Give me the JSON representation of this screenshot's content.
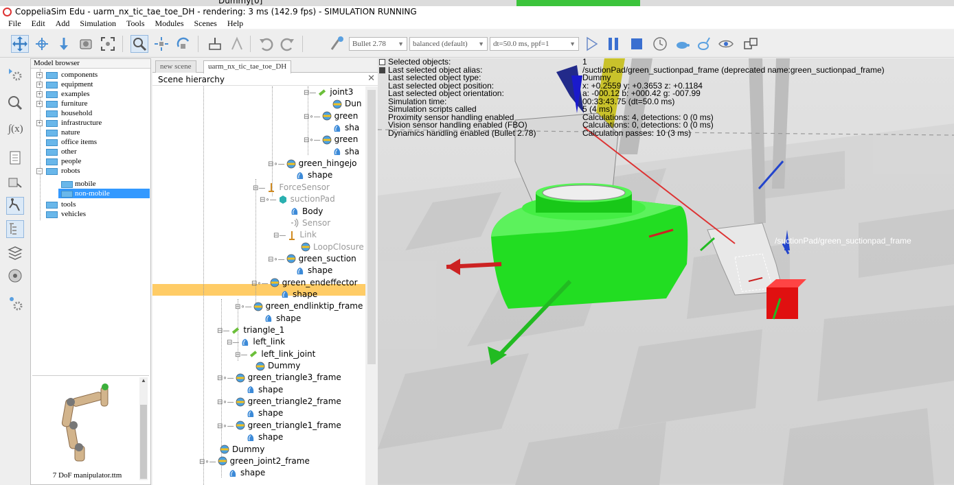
{
  "window": {
    "title": "CoppeliaSim Edu - uarm_nx_tic_tae_toe_DH - rendering: 3 ms (142.9 fps) - SIMULATION RUNNING",
    "top_strip_text": "Dummy[0]"
  },
  "menu": [
    "File",
    "Edit",
    "Add",
    "Simulation",
    "Tools",
    "Modules",
    "Scenes",
    "Help"
  ],
  "toolbar": {
    "physics_engine": "Bullet 2.78",
    "accuracy": "balanced (default)",
    "timestep": "dt=50.0 ms, ppf=1"
  },
  "model_browser": {
    "title": "Model browser",
    "items": [
      {
        "label": "components",
        "expandable": true
      },
      {
        "label": "equipment",
        "expandable": true
      },
      {
        "label": "examples",
        "expandable": true
      },
      {
        "label": "furniture",
        "expandable": true
      },
      {
        "label": "household",
        "expandable": false
      },
      {
        "label": "infrastructure",
        "expandable": true
      },
      {
        "label": "nature",
        "expandable": false
      },
      {
        "label": "office items",
        "expandable": false
      },
      {
        "label": "other",
        "expandable": false
      },
      {
        "label": "people",
        "expandable": false
      },
      {
        "label": "robots",
        "expandable": true
      },
      {
        "label": "mobile",
        "expandable": false
      },
      {
        "label": "non-mobile",
        "expandable": false,
        "selected": true
      },
      {
        "label": "tools",
        "expandable": false
      },
      {
        "label": "vehicles",
        "expandable": false
      }
    ],
    "thumbnail_caption": "7 DoF manipulator.ttm"
  },
  "scene": {
    "tabs": [
      "new scene",
      "uarm_nx_tic_tae_toe_DH"
    ],
    "active_tab": "uarm_nx_tic_tae_toe_DH",
    "hierarchy_title": "Scene hierarchy",
    "rows": [
      {
        "label": "joint3",
        "indent": 220,
        "icon": "joint",
        "exp": "⊟"
      },
      {
        "label": "Dun",
        "indent": 262,
        "icon": "dummy",
        "exp": ""
      },
      {
        "label": "green",
        "indent": 220,
        "icon": "dummy",
        "exp": "⊟∘"
      },
      {
        "label": "sha",
        "indent": 262,
        "icon": "shape",
        "exp": ""
      },
      {
        "label": "green",
        "indent": 220,
        "icon": "dummy",
        "exp": "⊟∘"
      },
      {
        "label": "sha",
        "indent": 262,
        "icon": "shape",
        "exp": ""
      },
      {
        "label": "green_hingejo",
        "indent": 168,
        "icon": "dummy",
        "exp": "⊟∘"
      },
      {
        "label": "shape",
        "indent": 208,
        "icon": "shape",
        "exp": ""
      },
      {
        "label": "ForceSensor",
        "indent": 146,
        "icon": "force",
        "exp": "⊟",
        "dim": true
      },
      {
        "label": "suctionPad",
        "indent": 156,
        "icon": "cube",
        "exp": "⊟∘",
        "dim": true
      },
      {
        "label": "Body",
        "indent": 200,
        "icon": "shape",
        "exp": ""
      },
      {
        "label": "Sensor",
        "indent": 200,
        "icon": "sensor",
        "exp": "",
        "dim": true
      },
      {
        "label": "Link",
        "indent": 176,
        "icon": "force",
        "exp": "⊟",
        "dim": true
      },
      {
        "label": "LoopClosure",
        "indent": 216,
        "icon": "dummy",
        "exp": "",
        "dim": true
      },
      {
        "label": "green_suction",
        "indent": 168,
        "icon": "dummy",
        "exp": "⊟∘",
        "selected": true
      },
      {
        "label": "shape",
        "indent": 208,
        "icon": "shape",
        "exp": ""
      },
      {
        "label": "green_endeffector",
        "indent": 144,
        "icon": "dummy",
        "exp": "⊟∘"
      },
      {
        "label": "shape",
        "indent": 186,
        "icon": "shape",
        "exp": ""
      },
      {
        "label": "green_endlinktip_frame",
        "indent": 120,
        "icon": "dummy",
        "exp": "⊟∘"
      },
      {
        "label": "shape",
        "indent": 162,
        "icon": "shape",
        "exp": ""
      },
      {
        "label": "triangle_1",
        "indent": 94,
        "icon": "joint",
        "exp": "⊟"
      },
      {
        "label": "left_link",
        "indent": 108,
        "icon": "shape",
        "exp": "⊟"
      },
      {
        "label": "left_link_joint",
        "indent": 120,
        "icon": "joint",
        "exp": "⊟"
      },
      {
        "label": "Dummy",
        "indent": 150,
        "icon": "dummy",
        "exp": ""
      },
      {
        "label": "green_triangle3_frame",
        "indent": 94,
        "icon": "dummy",
        "exp": "⊟∘"
      },
      {
        "label": "shape",
        "indent": 136,
        "icon": "shape",
        "exp": ""
      },
      {
        "label": "green_triangle2_frame",
        "indent": 94,
        "icon": "dummy",
        "exp": "⊟∘"
      },
      {
        "label": "shape",
        "indent": 136,
        "icon": "shape",
        "exp": ""
      },
      {
        "label": "green_triangle1_frame",
        "indent": 94,
        "icon": "dummy",
        "exp": "⊟∘"
      },
      {
        "label": "shape",
        "indent": 136,
        "icon": "shape",
        "exp": ""
      },
      {
        "label": "Dummy",
        "indent": 98,
        "icon": "dummy",
        "exp": ""
      },
      {
        "label": "green_joint2_frame",
        "indent": 68,
        "icon": "dummy",
        "exp": "⊟∘"
      },
      {
        "label": "shape",
        "indent": 110,
        "icon": "shape",
        "exp": ""
      }
    ]
  },
  "viewport": {
    "info": [
      {
        "key": "Selected objects:",
        "value": "1",
        "box": "white"
      },
      {
        "key": "Last selected object alias:",
        "value": "/suctionPad/green_suctionpad_frame   (deprecated name:green_suctionpad_frame)",
        "box": "dark"
      },
      {
        "key": "Last selected object type:",
        "value": "Dummy"
      },
      {
        "key": "Last selected object position:",
        "value": "x: +0.2559   y: +0.3653   z: +0.1184"
      },
      {
        "key": "Last selected object orientation:",
        "value": "a: -000.12   b: +000.42   g: -007.99"
      },
      {
        "key": "Simulation time:",
        "value": "00:33:43.75 (dt=50.0 ms)"
      },
      {
        "key": "Simulation scripts called",
        "value": "5 (4 ms)"
      },
      {
        "key": "Proximity sensor handling enabled",
        "value": "Calculations: 4, detections: 0 (0 ms)"
      },
      {
        "key": "Vision sensor handling enabled (FBO)",
        "value": "Calculations: 0, detections: 0 (0 ms)"
      },
      {
        "key": "Dynamics handling enabled (Bullet 2.78)",
        "value": "Calculation passes: 10 (3 ms)"
      }
    ],
    "object_label": "/suctionPad/green_suctionpad_frame"
  },
  "colors": {
    "selection_highlight": "#ffcc66",
    "browser_selection": "#3399ff",
    "suction_pad_green": "#22dd22",
    "cube_red": "#e01010"
  }
}
